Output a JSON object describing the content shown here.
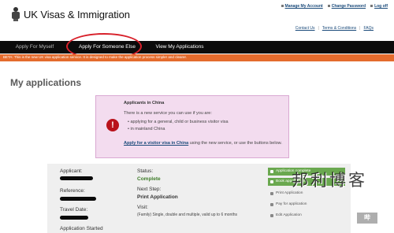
{
  "header": {
    "site_title": "UK Visas & Immigration",
    "top_links": [
      "Manage My Account",
      "Change Password",
      "Log off"
    ],
    "sub_links": [
      "Contact Us",
      "Terms & Conditions",
      "FAQs"
    ]
  },
  "nav": {
    "tabs": [
      {
        "label": "Apply For Myself"
      },
      {
        "label": "Apply For Someone Else"
      },
      {
        "label": "View My Applications"
      }
    ]
  },
  "beta": {
    "text": "BETA: This is the new UK visa application service. It is designed to make the application process simpler and clearer."
  },
  "page": {
    "title": "My applications"
  },
  "alert": {
    "title": "Applicants in China",
    "intro": "There is a new service you can use if you are:",
    "items": [
      "applying for a general, child or business visitor visa",
      "in mainland China"
    ],
    "link_text": "Apply for a visitor visa in China",
    "foot_text": " using the new service, or use the buttons below."
  },
  "application": {
    "applicant_label": "Applicant:",
    "reference_label": "Reference:",
    "travel_date_label": "Travel Date:",
    "started_label": "Application Started",
    "status_label": "Status:",
    "status_value": "Complete",
    "next_step_label": "Next Step:",
    "next_step_value": "Print Application",
    "visit_label": "Visit:",
    "visit_value": "(Family) Single, double and multiple, valid up to 6 months"
  },
  "actions": {
    "buttons": [
      {
        "label": "Application complete"
      },
      {
        "label": "Book appointment"
      },
      {
        "label": "Print Application"
      },
      {
        "label": "Pay for application"
      },
      {
        "label": "Edit Application"
      }
    ]
  },
  "watermark": {
    "text": "邦利博客",
    "logo": "哔"
  },
  "colors": {
    "navbar": "#0b0b0b",
    "beta": "#e46b2d",
    "alert_bg": "#f3dcef",
    "alert_icon": "#b9121b",
    "status_complete": "#3f7d2a",
    "action_green": "#6aa84f",
    "highlight_ring": "#d8202a"
  }
}
